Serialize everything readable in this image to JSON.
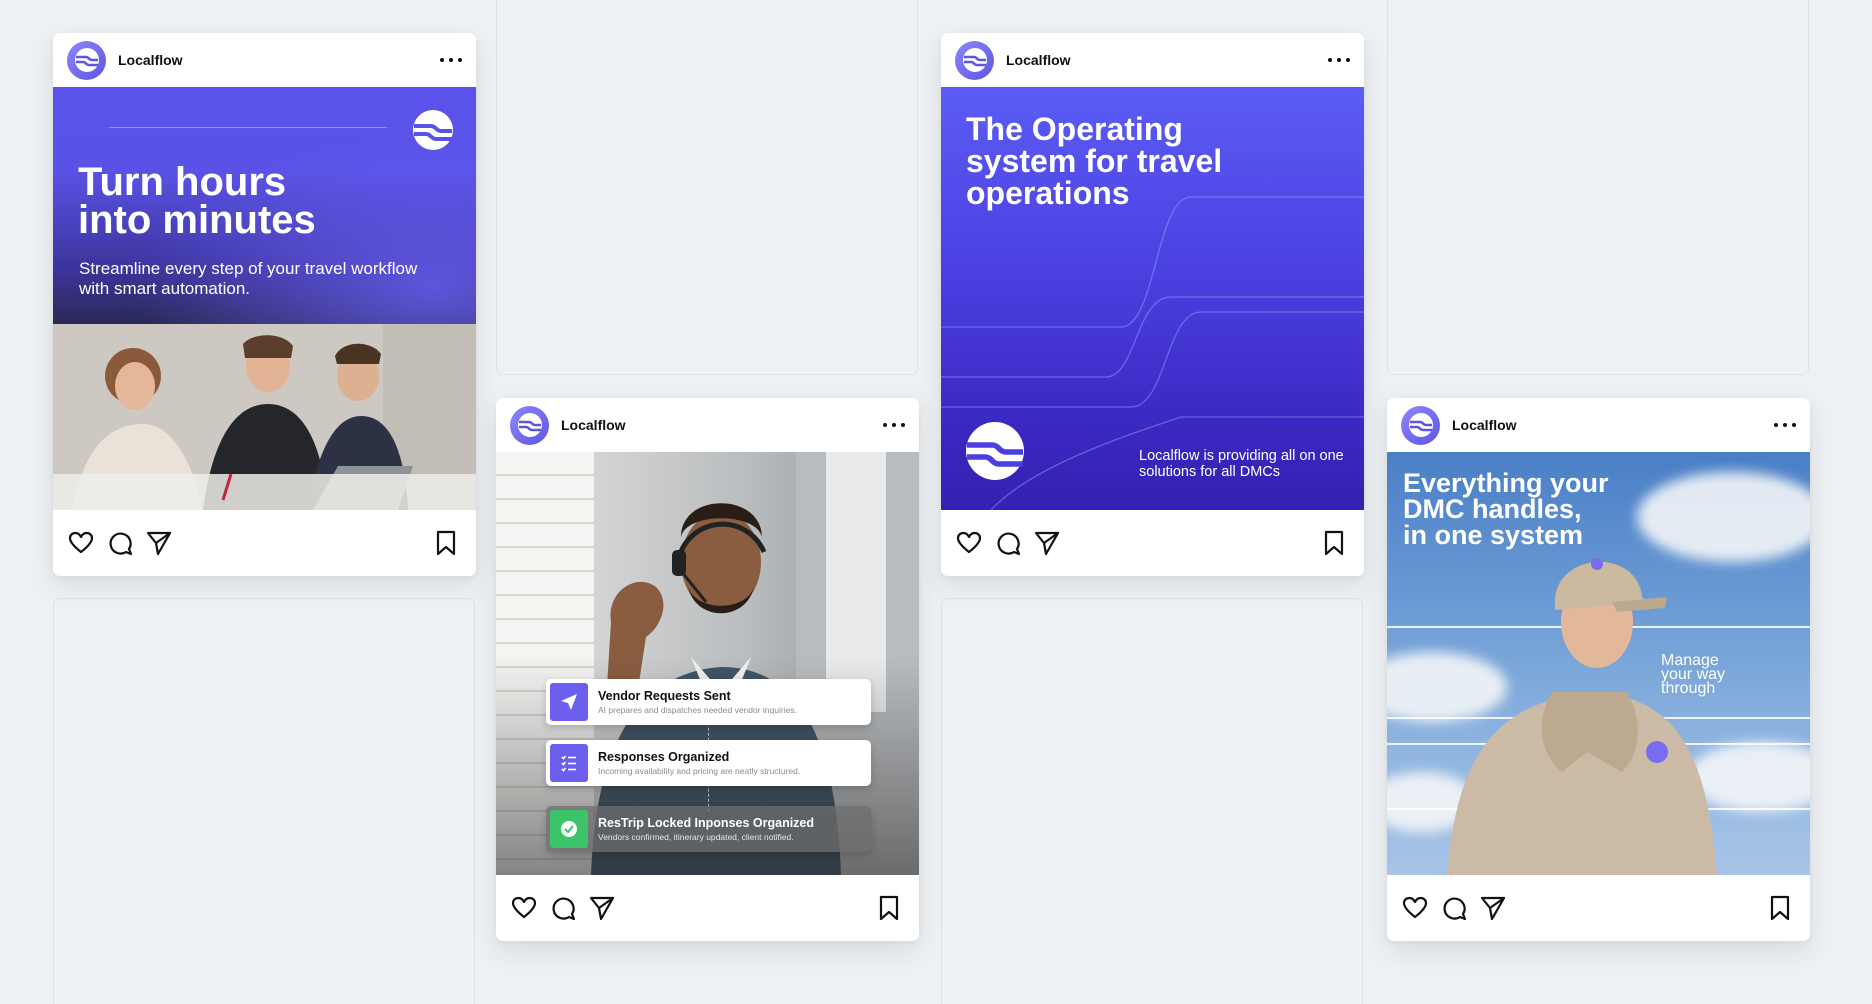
{
  "brand": {
    "accent": "#5b52ec",
    "accent_dark": "#3322b0",
    "check_green": "#3cc46a"
  },
  "posts": [
    {
      "username": "Localflow",
      "title_line1": "Turn hours",
      "title_line2": "into minutes",
      "subtitle": "Streamline every step of your travel workflow with smart automation."
    },
    {
      "username": "Localflow",
      "tasks": [
        {
          "icon": "paper-plane-icon",
          "title": "Vendor Requests Sent",
          "desc": "AI prepares and dispatches needed vendor inquiries."
        },
        {
          "icon": "checklist-icon",
          "title": "Responses Organized",
          "desc": "Incoming availability and pricing are neatly structured."
        },
        {
          "icon": "check-circle-icon",
          "title": "ResTrip Locked Inponses Organized",
          "desc": "Vendors confirmed, itinerary updated, client notified."
        }
      ]
    },
    {
      "username": "Localflow",
      "title_line1": "The Operating",
      "title_line2": "system for travel",
      "title_line3": "operations",
      "note": "Localflow is providing all on one solutions for all DMCs"
    },
    {
      "username": "Localflow",
      "title_line1": "Everything your",
      "title_line2": "DMC handles,",
      "title_line3": "in one system",
      "side_line1": "Manage",
      "side_line2": "your way",
      "side_line3": "through"
    }
  ]
}
